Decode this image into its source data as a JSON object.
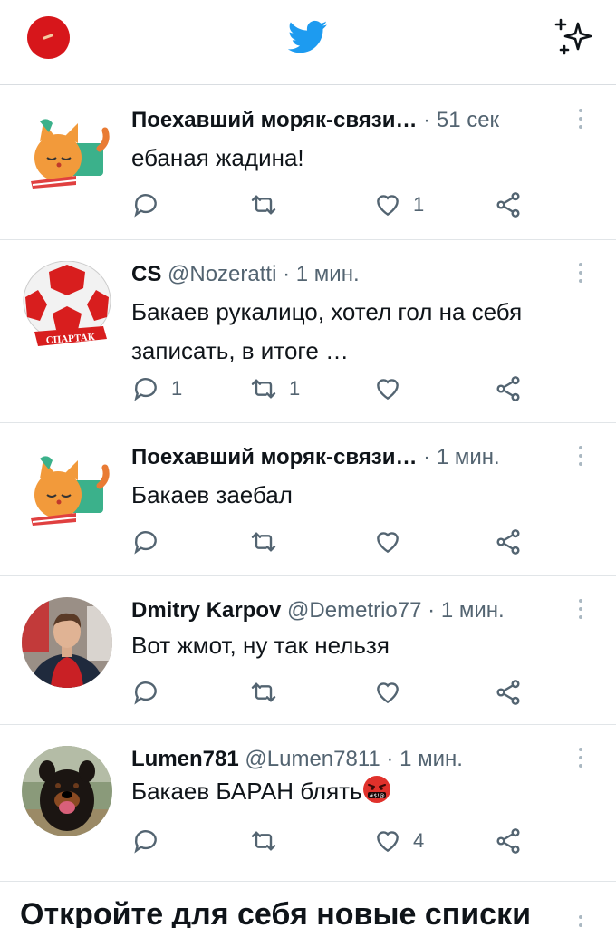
{
  "header": {
    "profile_icon": "profile-avatar",
    "logo_icon": "twitter-bird-icon",
    "top_tweets_icon": "sparkle-icon",
    "brand_color": "#1d9bf0"
  },
  "tweets": [
    {
      "name": "Поехавший моряк-связи…",
      "handle": "",
      "time": "51 сек",
      "text": "ебаная жадина!",
      "replies": "",
      "retweets": "",
      "likes": "1",
      "avatar": "cat-avatar"
    },
    {
      "name": "CS",
      "handle": "@Nozeratti",
      "time": "1 мин.",
      "text": "Бакаев рукалицо, хотел гол на себя записать, в итоге …",
      "replies": "1",
      "retweets": "1",
      "likes": "",
      "avatar": "spartak-ball-avatar",
      "avatar_label": "СПАРТАК"
    },
    {
      "name": "Поехавший моряк-связи…",
      "handle": "",
      "time": "1 мин.",
      "text": "Бакаев заебал",
      "replies": "",
      "retweets": "",
      "likes": "",
      "avatar": "cat-avatar"
    },
    {
      "name": "Dmitry Karpov",
      "handle": "@Demetrio77",
      "time": "1 мин.",
      "text": "Вот жмот, ну так нельзя",
      "replies": "",
      "retweets": "",
      "likes": "",
      "avatar": "person-photo-avatar"
    },
    {
      "name": "Lumen781",
      "handle": "@Lumen7811",
      "time": "1 мин.",
      "text": "Бакаев БАРАН блять",
      "text_emoji": "angry-face-emoji",
      "replies": "",
      "retweets": "",
      "likes": "4",
      "avatar": "dog-photo-avatar"
    }
  ],
  "lists_section": {
    "title": "Откройте для себя новые списки"
  }
}
